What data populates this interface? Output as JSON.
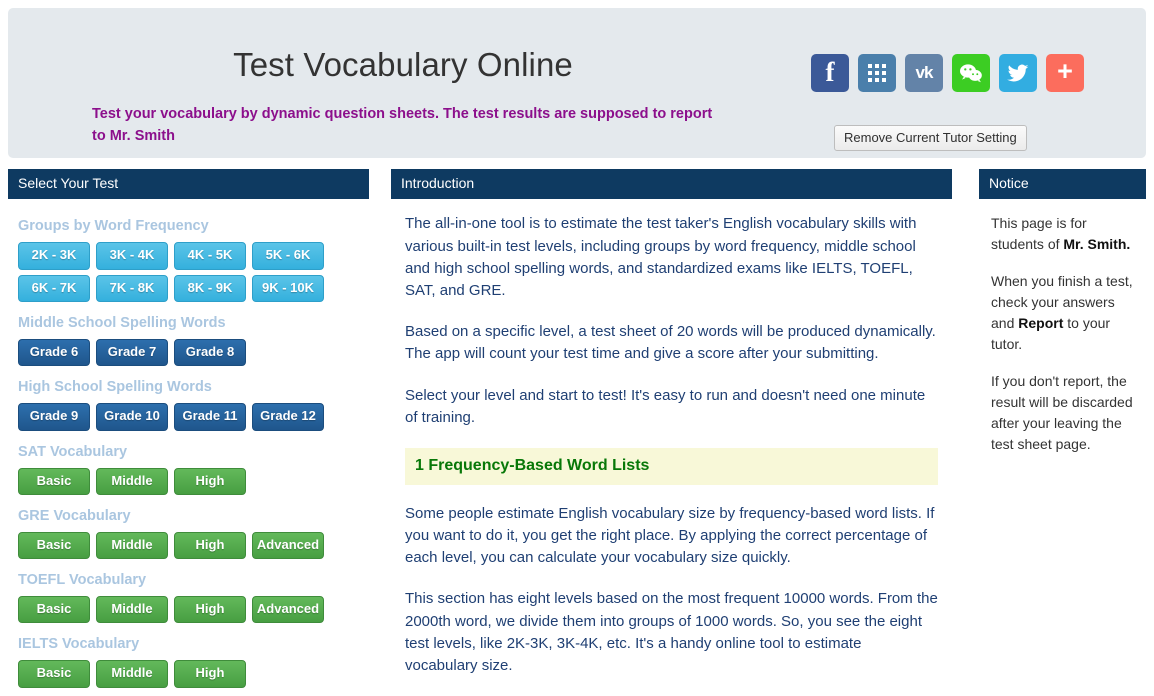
{
  "header": {
    "title": "Test Vocabulary Online",
    "subtitle": "Test your vocabulary by dynamic question sheets. The test results are supposed to report to Mr. Smith",
    "tutor_button": "Remove Current Tutor Setting",
    "social": [
      {
        "name": "facebook",
        "glyph": "f",
        "color": "#3b5998"
      },
      {
        "name": "apps-grid",
        "glyph": "",
        "color": "#4a7fab"
      },
      {
        "name": "vk",
        "glyph": "vk",
        "color": "#6383a8"
      },
      {
        "name": "wechat",
        "glyph": "",
        "color": "#3ccd23"
      },
      {
        "name": "twitter",
        "glyph": "",
        "color": "#32ade1"
      },
      {
        "name": "share-more",
        "glyph": "+",
        "color": "#fc6d5d"
      }
    ]
  },
  "sidebar": {
    "heading": "Select Your Test",
    "groups": [
      {
        "title": "Groups by Word Frequency",
        "style": "cyan",
        "buttons": [
          "2K - 3K",
          "3K - 4K",
          "4K - 5K",
          "5K - 6K",
          "6K - 7K",
          "7K - 8K",
          "8K - 9K",
          "9K - 10K"
        ]
      },
      {
        "title": "Middle School Spelling Words",
        "style": "blue",
        "buttons": [
          "Grade 6",
          "Grade 7",
          "Grade 8"
        ]
      },
      {
        "title": "High School Spelling Words",
        "style": "blue",
        "buttons": [
          "Grade 9",
          "Grade 10",
          "Grade 11",
          "Grade 12"
        ]
      },
      {
        "title": "SAT Vocabulary",
        "style": "green",
        "buttons": [
          "Basic",
          "Middle",
          "High"
        ]
      },
      {
        "title": "GRE Vocabulary",
        "style": "green",
        "buttons": [
          "Basic",
          "Middle",
          "High",
          "Advanced"
        ]
      },
      {
        "title": "TOEFL Vocabulary",
        "style": "green",
        "buttons": [
          "Basic",
          "Middle",
          "High",
          "Advanced"
        ]
      },
      {
        "title": "IELTS Vocabulary",
        "style": "green",
        "buttons": [
          "Basic",
          "Middle",
          "High"
        ]
      }
    ]
  },
  "introduction": {
    "heading": "Introduction",
    "paragraph1": "The all-in-one tool is to estimate the test taker's English vocabulary skills with various built-in test levels, including groups by word frequency, middle school and high school spelling words, and standardized exams like IELTS, TOEFL, SAT, and GRE.",
    "paragraph2": "Based on a specific level, a test sheet of 20 words will be produced dynamically. The app will count your test time and give a score after your submitting.",
    "paragraph3": "Select your level and start to test! It's easy to run and doesn't need one minute of training.",
    "section_heading": "1 Frequency-Based Word Lists",
    "paragraph4": "Some people estimate English vocabulary size by frequency-based word lists. If you want to do it, you get the right place. By applying the correct percentage of each level, you can calculate your vocabulary size quickly.",
    "paragraph5": "This section has eight levels based on the most frequent 10000 words. From the 2000th word, we divide them into groups of 1000 words. So, you see the eight test levels, like 2K-3K, 3K-4K, etc. It's a handy online tool to estimate vocabulary size."
  },
  "notice": {
    "heading": "Notice",
    "paragraph1_pre": "This page is for students of ",
    "paragraph1_bold": "Mr. Smith.",
    "paragraph2_pre": "When you finish a test, check your answers and ",
    "paragraph2_bold": "Report",
    "paragraph2_post": " to your tutor.",
    "paragraph3": "If you don't report, the result will be discarded after your leaving the test sheet page."
  },
  "colors": {
    "panel_header": "#0e3a61",
    "header_bg": "#e4e9ed",
    "subtitle": "#8c0f8c",
    "body_text": "#1f3f73",
    "section_head_bg": "#f8f8d8",
    "section_head_text": "#087808",
    "group_title": "#aac6e0"
  }
}
